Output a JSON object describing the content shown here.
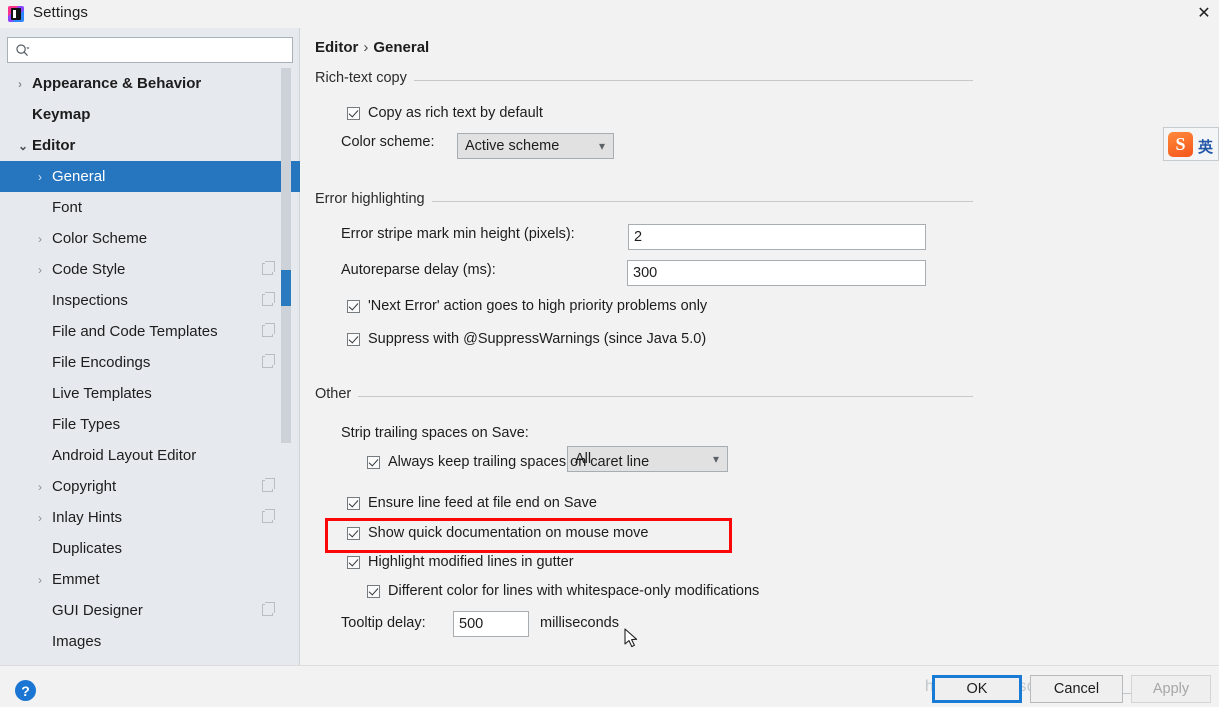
{
  "window": {
    "title": "Settings",
    "app_icon": "intellij-idea-icon",
    "close_label": "✕"
  },
  "search": {
    "icon": "search-icon",
    "value": "",
    "placeholder": ""
  },
  "sidebar": {
    "items": [
      {
        "label": "Appearance & Behavior",
        "level": 1,
        "bold": true,
        "arrow": "right",
        "badge": false,
        "selected": false
      },
      {
        "label": "Keymap",
        "level": 1,
        "bold": true,
        "arrow": "none",
        "badge": false,
        "selected": false
      },
      {
        "label": "Editor",
        "level": 1,
        "bold": true,
        "arrow": "down",
        "badge": false,
        "selected": false
      },
      {
        "label": "General",
        "level": 2,
        "bold": false,
        "arrow": "right",
        "badge": false,
        "selected": true
      },
      {
        "label": "Font",
        "level": 2,
        "bold": false,
        "arrow": "none",
        "badge": false,
        "selected": false
      },
      {
        "label": "Color Scheme",
        "level": 2,
        "bold": false,
        "arrow": "right",
        "badge": false,
        "selected": false
      },
      {
        "label": "Code Style",
        "level": 2,
        "bold": false,
        "arrow": "right",
        "badge": true,
        "selected": false
      },
      {
        "label": "Inspections",
        "level": 2,
        "bold": false,
        "arrow": "none",
        "badge": true,
        "selected": false
      },
      {
        "label": "File and Code Templates",
        "level": 2,
        "bold": false,
        "arrow": "none",
        "badge": true,
        "selected": false
      },
      {
        "label": "File Encodings",
        "level": 2,
        "bold": false,
        "arrow": "none",
        "badge": true,
        "selected": false
      },
      {
        "label": "Live Templates",
        "level": 2,
        "bold": false,
        "arrow": "none",
        "badge": false,
        "selected": false
      },
      {
        "label": "File Types",
        "level": 2,
        "bold": false,
        "arrow": "none",
        "badge": false,
        "selected": false
      },
      {
        "label": "Android Layout Editor",
        "level": 2,
        "bold": false,
        "arrow": "none",
        "badge": false,
        "selected": false
      },
      {
        "label": "Copyright",
        "level": 2,
        "bold": false,
        "arrow": "right",
        "badge": true,
        "selected": false
      },
      {
        "label": "Inlay Hints",
        "level": 2,
        "bold": false,
        "arrow": "right",
        "badge": true,
        "selected": false
      },
      {
        "label": "Duplicates",
        "level": 2,
        "bold": false,
        "arrow": "none",
        "badge": false,
        "selected": false
      },
      {
        "label": "Emmet",
        "level": 2,
        "bold": false,
        "arrow": "right",
        "badge": false,
        "selected": false
      },
      {
        "label": "GUI Designer",
        "level": 2,
        "bold": false,
        "arrow": "none",
        "badge": true,
        "selected": false
      },
      {
        "label": "Images",
        "level": 2,
        "bold": false,
        "arrow": "none",
        "badge": false,
        "selected": false
      }
    ]
  },
  "breadcrumb": {
    "root": "Editor",
    "separator": "›",
    "leaf": "General"
  },
  "sections": {
    "rich_text_copy": {
      "title": "Rich-text copy",
      "copy_rich_text": {
        "label": "Copy as rich text by default",
        "checked": true
      },
      "color_scheme": {
        "label": "Color scheme:",
        "value": "Active scheme"
      }
    },
    "error_highlighting": {
      "title": "Error highlighting",
      "stripe_min_height": {
        "label": "Error stripe mark min height (pixels):",
        "value": "2"
      },
      "autoreparse_delay": {
        "label": "Autoreparse delay (ms):",
        "value": "300"
      },
      "next_error": {
        "label": "'Next Error' action goes to high priority problems only",
        "checked": true
      },
      "suppress": {
        "label": "Suppress with @SuppressWarnings (since Java 5.0)",
        "checked": true
      }
    },
    "other": {
      "title": "Other",
      "strip_trailing": {
        "label": "Strip trailing spaces on Save:",
        "value": "All"
      },
      "keep_caret_line": {
        "label": "Always keep trailing spaces on caret line",
        "checked": true
      },
      "ensure_line_feed": {
        "label": "Ensure line feed at file end on Save",
        "checked": true
      },
      "quick_doc": {
        "label": "Show quick documentation on mouse move",
        "checked": true
      },
      "highlight_gutter": {
        "label": "Highlight modified lines in gutter",
        "checked": true
      },
      "whitespace_color": {
        "label": "Different color for lines with whitespace-only modifications",
        "checked": true
      },
      "tooltip_delay": {
        "label": "Tooltip delay:",
        "value": "500",
        "unit": "milliseconds"
      }
    }
  },
  "annotation": {
    "color": "#fb0707"
  },
  "ime": {
    "logo": "S",
    "mode": "英"
  },
  "footer": {
    "help_label": "?",
    "ok_label": "OK",
    "cancel_label": "Cancel",
    "apply_label": "Apply"
  },
  "watermark": {
    "text": "https://blog.csdn.net/weixin_40816798"
  },
  "colors": {
    "accent": "#2675bf",
    "selection": "#2675bf",
    "annotation_red": "#fb0707",
    "sidebar_bg": "#e6eaee",
    "content_bg": "#f2f2f2",
    "primary_button_border": "#1a7bd4"
  }
}
